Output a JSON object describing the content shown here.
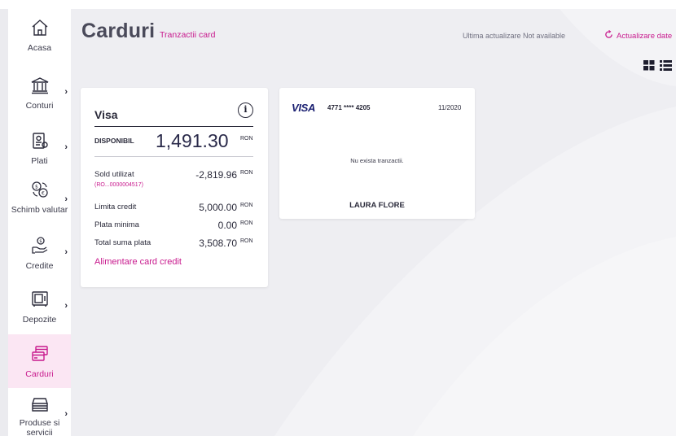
{
  "sidebar": {
    "items": [
      {
        "label": "Acasa",
        "icon": "home-icon",
        "chevron": false
      },
      {
        "label": "Conturi",
        "icon": "bank-icon",
        "chevron": true
      },
      {
        "label": "Plati",
        "icon": "payment-doc-icon",
        "chevron": true
      },
      {
        "label": "Schimb valutar",
        "icon": "currency-exchange-icon",
        "chevron": true
      },
      {
        "label": "Credite",
        "icon": "credit-hand-icon",
        "chevron": true
      },
      {
        "label": "Depozite",
        "icon": "safe-icon",
        "chevron": true
      },
      {
        "label": "Carduri",
        "icon": "cards-icon",
        "chevron": false,
        "active": true
      },
      {
        "label": "Produse si servicii",
        "icon": "products-stack-icon",
        "chevron": true
      }
    ],
    "chevron_glyph": "›"
  },
  "header": {
    "title": "Carduri",
    "subtitle": "Tranzactii card",
    "last_update": "Ultima actualizare Not available",
    "refresh_label": "Actualizare date"
  },
  "card_detail": {
    "title": "Visa",
    "info_glyph": "i",
    "available_label": "DISPONIBIL",
    "available_value": "1,491.30",
    "currency": "RON",
    "rows": [
      {
        "label": "Sold utilizat",
        "value": "-2,819.96",
        "currency": "RON"
      },
      {
        "label": "Limita credit",
        "value": "5,000.00",
        "currency": "RON"
      },
      {
        "label": "Plata minima",
        "value": "0.00",
        "currency": "RON"
      },
      {
        "label": "Total suma plata",
        "value": "3,508.70",
        "currency": "RON"
      }
    ],
    "account_link": "(RO...0000004517)",
    "topup_link": "Alimentare card credit"
  },
  "card_tile": {
    "brand": "VISA",
    "number": "4771 **** 4205",
    "expiry": "11/2020",
    "no_transactions": "Nu exista tranzactii.",
    "holder": "LAURA FLORE"
  },
  "colors": {
    "accent": "#c8198d",
    "active_bg": "#fbe6f3",
    "visa_blue": "#1a1f71"
  }
}
